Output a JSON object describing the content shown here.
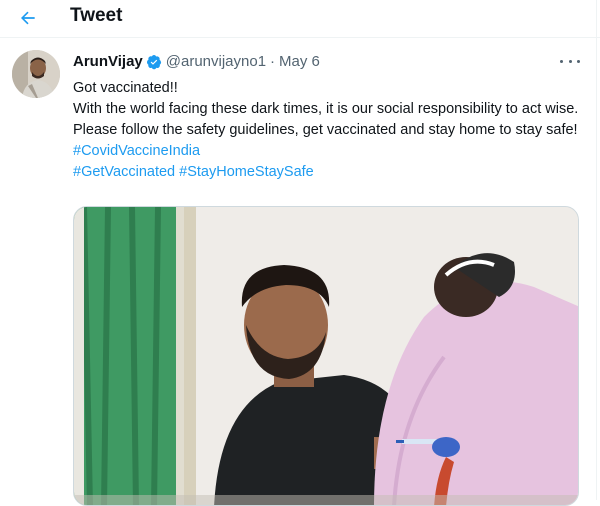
{
  "header": {
    "title": "Tweet",
    "back_icon": "arrow-left-icon"
  },
  "colors": {
    "accent": "#1d9bf0",
    "text": "#0f1419",
    "muted": "#536471"
  },
  "tweet": {
    "display_name": "ArunVijay",
    "handle": "@arunvijayno1",
    "separator": "·",
    "date": "May 6",
    "lines": [
      "Got vaccinated!!",
      "With the world facing these dark times, it is our social responsibility to act wise. Please follow the safety guidelines, get vaccinated and stay home to stay safe!"
    ],
    "hashtags": [
      "#CovidVaccineIndia",
      "#GetVaccinated",
      "#StayHomeStaySafe"
    ],
    "media_alt": "Photo of a man receiving a vaccine shot from a nurse"
  }
}
